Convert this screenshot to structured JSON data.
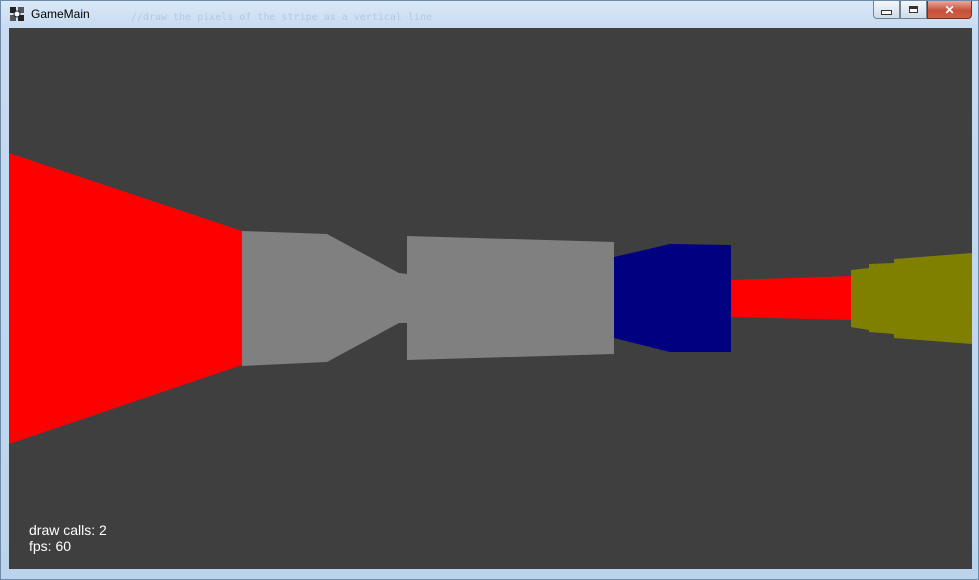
{
  "window": {
    "title": "GameMain",
    "background_text": "//draw the pixels of the stripe as a vertical line",
    "buttons": {
      "minimize": "minimize",
      "maximize": "maximize",
      "close": "✕"
    }
  },
  "scene": {
    "background_color": "#3f3f3f",
    "wall_colors": {
      "red": "#ff0000",
      "gray": "#808080",
      "navy": "#000080",
      "olive": "#808000"
    }
  },
  "hud": {
    "draw_calls": "draw calls: 2",
    "fps": "fps: 60"
  }
}
